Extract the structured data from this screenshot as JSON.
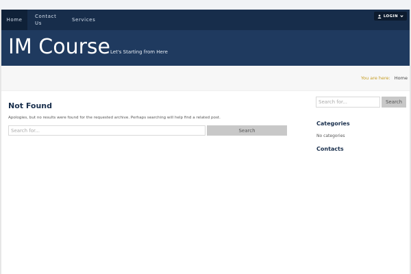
{
  "nav": {
    "items": [
      {
        "label": "Home"
      },
      {
        "label_line1": "Contact",
        "label_line2": "Us"
      },
      {
        "label": "Services"
      }
    ],
    "login_label": "LOGIN",
    "login_icon": "user-icon",
    "login_caret_icon": "chevron-down-icon"
  },
  "header": {
    "title": "IM Course",
    "tagline": "Let's Starting from Here"
  },
  "breadcrumb": {
    "prefix": "You are here:",
    "current": "Home"
  },
  "main": {
    "heading": "Not Found",
    "message": "Apologies, but no results were found for the requested archive. Perhaps searching will help find a related post.",
    "search_placeholder": "Search for...",
    "search_button": "Search"
  },
  "sidebar": {
    "search_placeholder": "Search for...",
    "search_button": "Search",
    "categories_title": "Categories",
    "categories_empty": "No categories",
    "contacts_title": "Contacts"
  },
  "colors": {
    "navbar": "#172d4b",
    "hero": "#1f3a5f",
    "breadcrumb_label": "#c59b1f",
    "button_gray": "#c8c8c8"
  }
}
